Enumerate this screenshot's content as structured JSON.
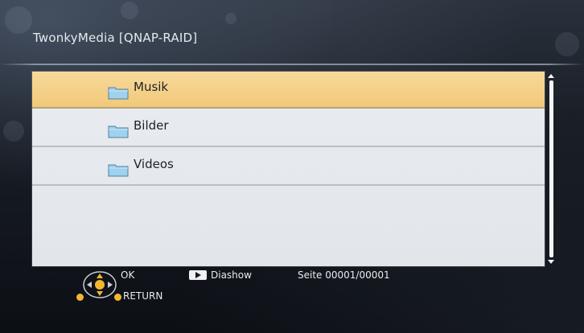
{
  "header": {
    "title": "TwonkyMedia [QNAP-RAID]"
  },
  "list": {
    "items": [
      {
        "label": "Musik",
        "icon": "folder-icon",
        "selected": true
      },
      {
        "label": "Bilder",
        "icon": "folder-icon",
        "selected": false
      },
      {
        "label": "Videos",
        "icon": "folder-icon",
        "selected": false
      }
    ]
  },
  "footer": {
    "ok_label": "OK",
    "return_label": "RETURN",
    "diashow_label": "Diashow",
    "page_label": "Seite 00001/00001"
  },
  "colors": {
    "selection": "#f2c97a",
    "list_background": "#e6e9ee",
    "accent_button": "#f2b630",
    "text_light": "#e8ebef"
  },
  "icons": {
    "navigation": "dpad-icon",
    "diashow": "play-icon",
    "folder": "folder-icon"
  }
}
